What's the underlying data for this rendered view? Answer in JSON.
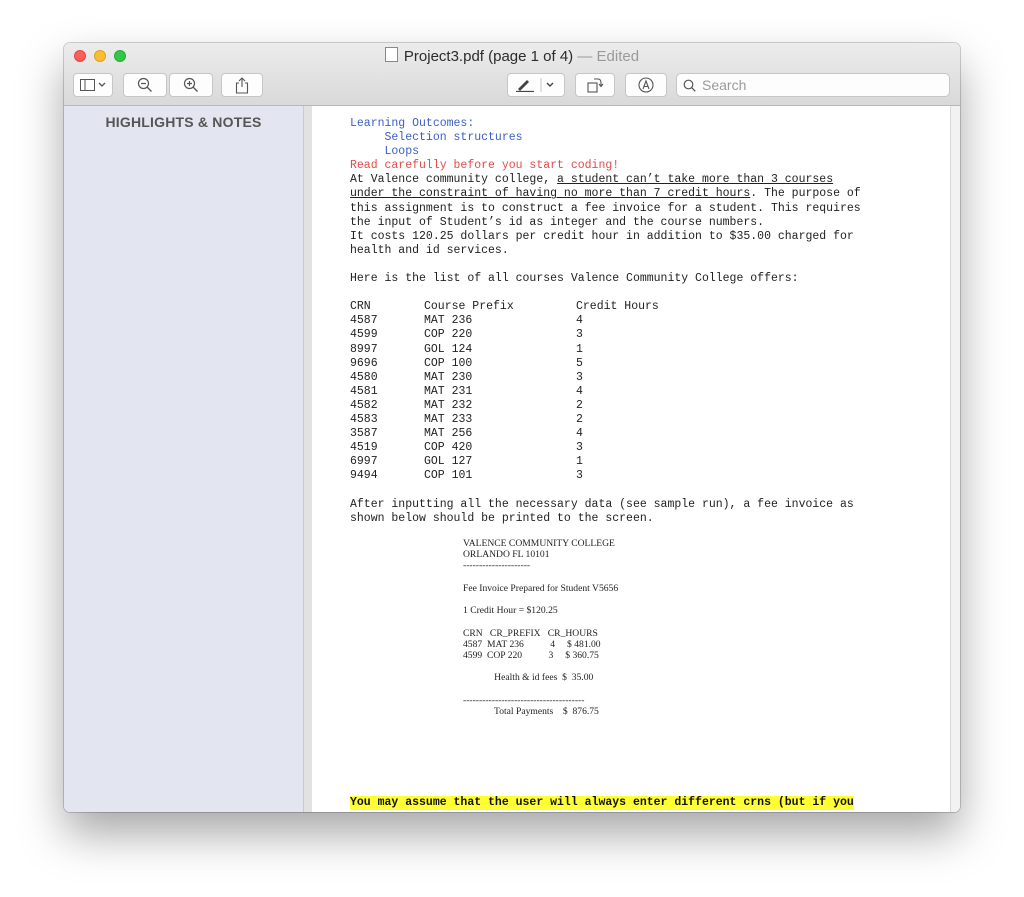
{
  "window": {
    "title_file": "Project3.pdf (page 1 of 4)",
    "title_sep": " — ",
    "title_status": "Edited"
  },
  "toolbar": {
    "search_placeholder": "Search",
    "icons": [
      "sidebar-toggle-icon",
      "chevron-down-icon",
      "zoom-out-icon",
      "zoom-in-icon",
      "share-icon",
      "markup-pen-icon",
      "chevron-down-icon",
      "rotate-icon",
      "markup-toolbar-icon",
      "search-icon"
    ]
  },
  "sidebar": {
    "heading": "HIGHLIGHTS & NOTES"
  },
  "document": {
    "outcomes_title": "Learning Outcomes:",
    "outcome_1": "     Selection structures",
    "outcome_2": "     Loops",
    "warning": "Read carefully before you start coding!",
    "para1_a": "At Valence community college, ",
    "para1_b": "a student can’t take more than 3 courses",
    "para1_c": "under the constraint of having no more than 7 credit hours",
    "para1_d": ". The purpose of",
    "para1_e": "this assignment is to construct a fee invoice for a student. This requires",
    "para1_f": "the input of Student’s id as integer and the course numbers.",
    "para1_g": "It costs 120.25 dollars per credit hour in addition to $35.00 charged for",
    "para1_h": "health and id services.",
    "list_intro": "Here is the list of all courses Valence Community College offers:",
    "table_headers": [
      "CRN",
      "Course Prefix",
      "Credit Hours"
    ],
    "courses": [
      [
        "4587",
        "MAT 236",
        "4"
      ],
      [
        "4599",
        "COP 220",
        "3"
      ],
      [
        "8997",
        "GOL 124",
        "1"
      ],
      [
        "9696",
        "COP 100",
        "5"
      ],
      [
        "4580",
        "MAT 230",
        "3"
      ],
      [
        "4581",
        "MAT 231",
        "4"
      ],
      [
        "4582",
        "MAT 232",
        "2"
      ],
      [
        "4583",
        "MAT 233",
        "2"
      ],
      [
        "3587",
        "MAT 256",
        "4"
      ],
      [
        "4519",
        "COP 420",
        "3"
      ],
      [
        "6997",
        "GOL 127",
        "1"
      ],
      [
        "9494",
        "COP 101",
        "3"
      ]
    ],
    "after_1": "After inputting all the necessary data (see sample run), a fee invoice as",
    "after_2": "shown below should be printed to the screen.",
    "invoice_lines": [
      "VALENCE COMMUNITY COLLEGE",
      "ORLANDO FL 10101",
      "---------------------",
      "",
      "Fee Invoice Prepared for Student V5656",
      "",
      "1 Credit Hour = $120.25",
      "",
      "CRN   CR_PREFIX   CR_HOURS",
      "4587  MAT 236           4     $ 481.00",
      "4599  COP 220           3     $ 360.75",
      "",
      "             Health & id fees  $  35.00",
      "",
      "--------------------------------------",
      "             Total Payments    $  876.75"
    ],
    "highlight_text": "You may assume that the user will always enter different crns (but if you"
  }
}
